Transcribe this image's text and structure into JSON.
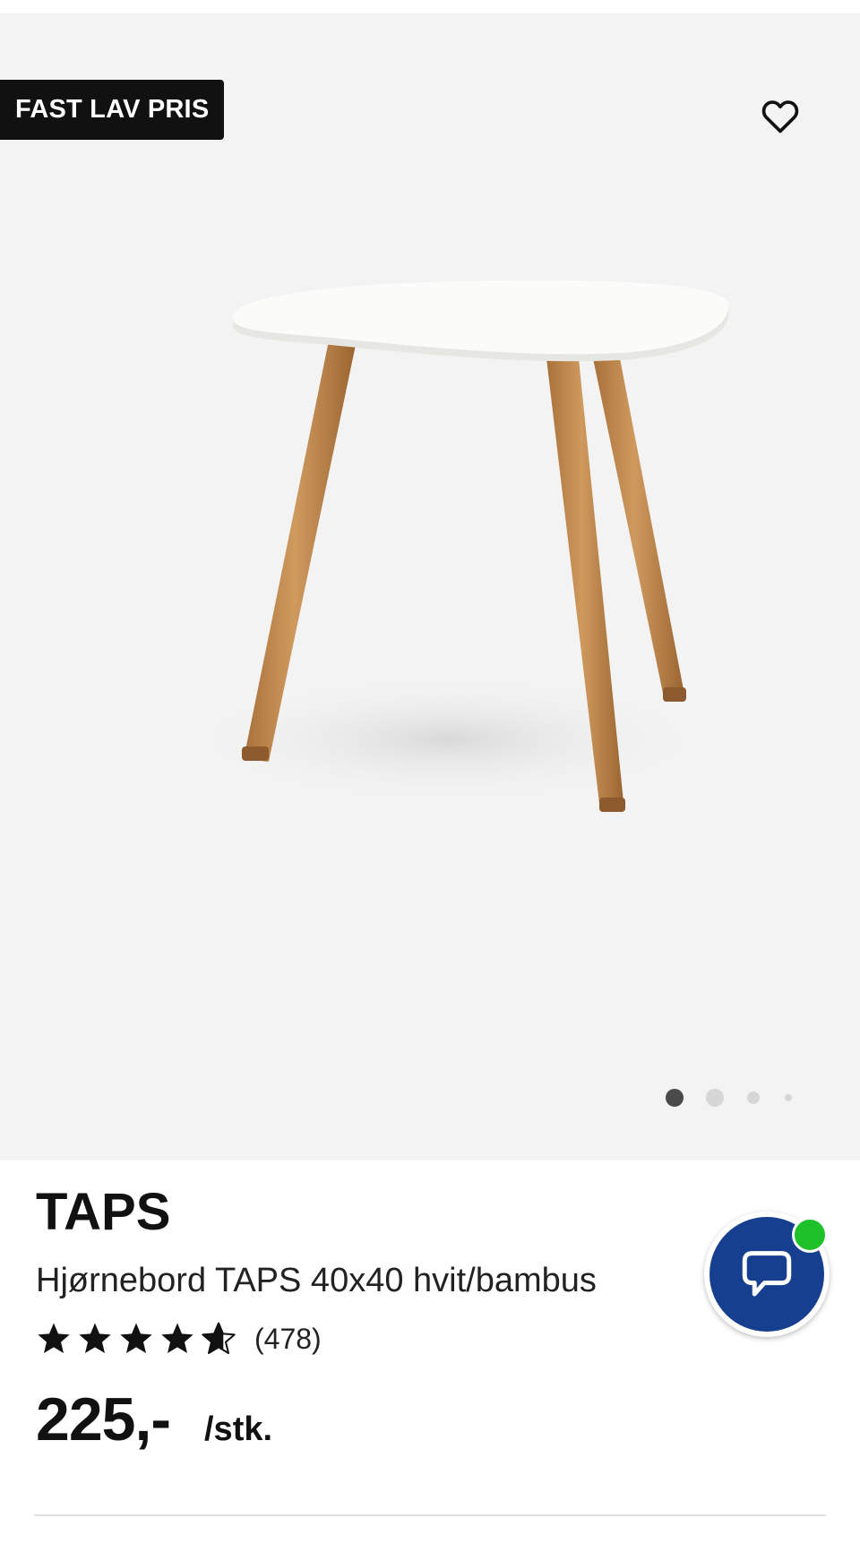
{
  "badge": {
    "label": "FAST LAV PRIS"
  },
  "gallery": {
    "image": "product-photo-side-table",
    "slide_count": 4,
    "active_slide": 1
  },
  "product": {
    "brand": "TAPS",
    "title": "Hjørnebord TAPS 40x40 hvit/bambus",
    "rating": 4.5,
    "rating_max": 5,
    "review_count": "(478)",
    "price": "225,-",
    "unit": "/stk."
  },
  "icons": {
    "favorite": "heart-outline-icon",
    "chat": "chat-bubble-icon",
    "star": "star-icon"
  },
  "colors": {
    "badge_bg": "#111111",
    "chat_bg": "#163f8f",
    "online": "#1ec12a",
    "dot_active": "#4a4a4a",
    "dot_inactive": "#d6d6d6"
  }
}
